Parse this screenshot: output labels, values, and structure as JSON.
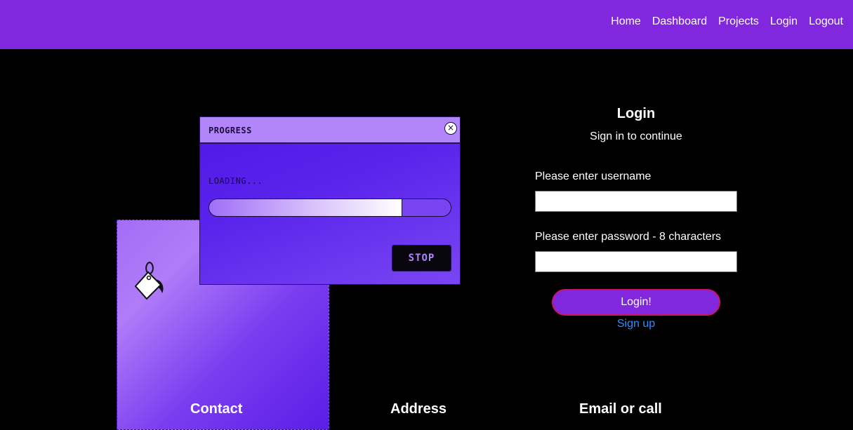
{
  "nav": {
    "items": [
      "Home",
      "Dashboard",
      "Projects",
      "Login",
      "Logout"
    ]
  },
  "progress_window": {
    "title": "PROGRESS",
    "close_glyph": "×",
    "loading_text": "LOADING...",
    "progress_fraction": 0.8,
    "stop_label": "STOP"
  },
  "illustration": {
    "icon": "paint-bucket-icon"
  },
  "login": {
    "title": "Login",
    "subtitle": "Sign in to continue",
    "username_label": "Please enter username",
    "username_value": "",
    "password_label": "Please enter password - 8 characters",
    "password_value": "",
    "submit_label": "Login!",
    "signup_label": "Sign up"
  },
  "footer": {
    "contact": "Contact",
    "address": "Address",
    "email": "Email or call"
  },
  "colors": {
    "brand": "#8128de",
    "link": "#2f8cff",
    "background": "#000000"
  }
}
